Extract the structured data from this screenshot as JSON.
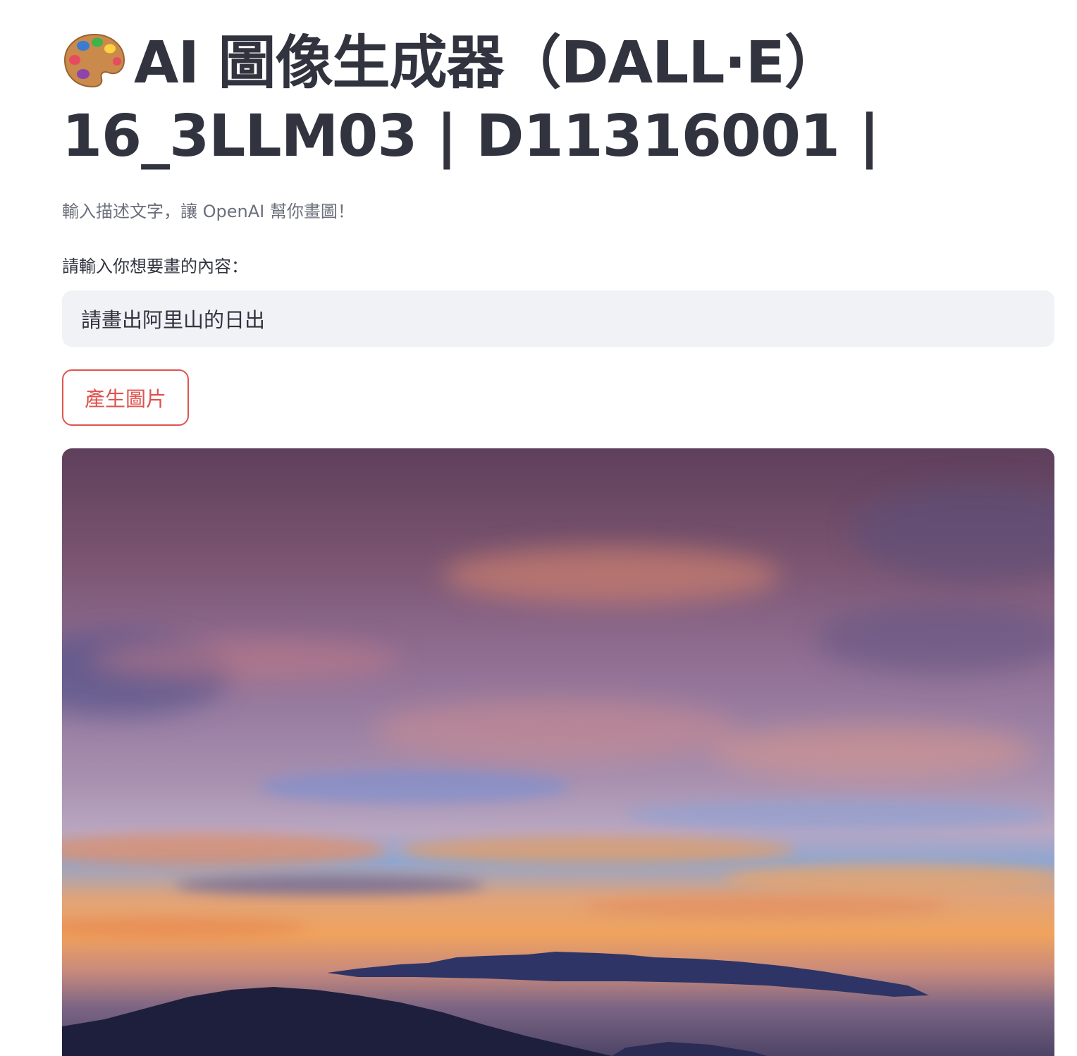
{
  "header": {
    "icon": "artist-palette-icon",
    "title": "AI 圖像生成器（DALL·E）16_3LLM03 | D11316001 |"
  },
  "subtitle": "輸入描述文字，讓 OpenAI 幫你畫圖！",
  "prompt": {
    "label": "請輸入你想要畫的內容：",
    "value": "請畫出阿里山的日出"
  },
  "generate_button": {
    "label": "產生圖片",
    "color": "#e0534f"
  },
  "result": {
    "icon": "generated-image"
  },
  "colors": {
    "text": "#31333f",
    "muted_text": "#6b6f7b",
    "input_background": "#f0f2f6",
    "accent": "#e0534f"
  }
}
